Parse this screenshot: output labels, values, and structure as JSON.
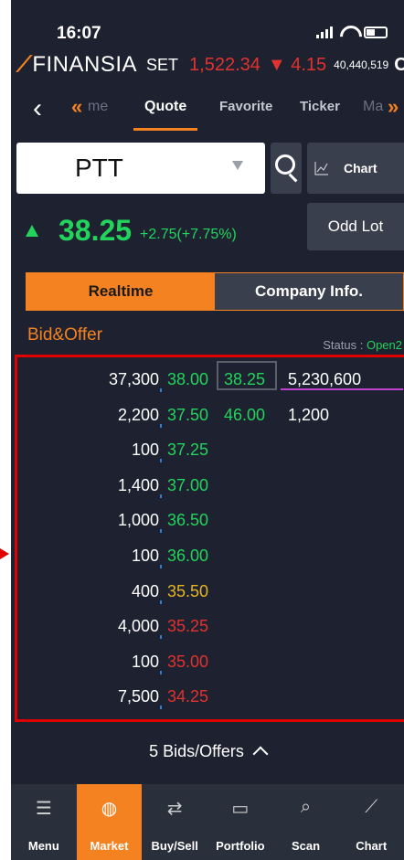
{
  "status": {
    "time": "16:07"
  },
  "ticker": {
    "brand": "FINANSIA",
    "index_name": "SET",
    "index_value": "1,522.34",
    "index_change": "▼ 4.15",
    "index_volume": "40,440,519",
    "overflow": "C"
  },
  "tabs": [
    {
      "label": "me"
    },
    {
      "label": "Quote"
    },
    {
      "label": "Favorite"
    },
    {
      "label": "Ticker"
    },
    {
      "label": "Ma"
    }
  ],
  "search": {
    "symbol": "PTT"
  },
  "chart_button": {
    "label": "Chart"
  },
  "price": {
    "last": "38.25",
    "change": "+2.75(+7.75%)"
  },
  "odd_lot_button": {
    "label": "Odd Lot"
  },
  "subtabs": {
    "realtime": "Realtime",
    "company": "Company Info."
  },
  "bid_offer": {
    "title": "Bid&Offer",
    "status_label": "Status :",
    "status_value": "Open2",
    "rows": [
      {
        "bid_volume": "37,300",
        "bid": "38.00",
        "bid_color": "g",
        "offer": "38.25",
        "offer_volume": "5,230,600"
      },
      {
        "bid_volume": "2,200",
        "bid": "37.50",
        "bid_color": "g",
        "offer": "46.00",
        "offer_volume": "1,200"
      },
      {
        "bid_volume": "100",
        "bid": "37.25",
        "bid_color": "g",
        "offer": "",
        "offer_volume": ""
      },
      {
        "bid_volume": "1,400",
        "bid": "37.00",
        "bid_color": "g",
        "offer": "",
        "offer_volume": ""
      },
      {
        "bid_volume": "1,000",
        "bid": "36.50",
        "bid_color": "g",
        "offer": "",
        "offer_volume": ""
      },
      {
        "bid_volume": "100",
        "bid": "36.00",
        "bid_color": "g",
        "offer": "",
        "offer_volume": ""
      },
      {
        "bid_volume": "400",
        "bid": "35.50",
        "bid_color": "y",
        "offer": "",
        "offer_volume": ""
      },
      {
        "bid_volume": "4,000",
        "bid": "35.25",
        "bid_color": "r",
        "offer": "",
        "offer_volume": ""
      },
      {
        "bid_volume": "100",
        "bid": "35.00",
        "bid_color": "r",
        "offer": "",
        "offer_volume": ""
      },
      {
        "bid_volume": "7,500",
        "bid": "34.25",
        "bid_color": "r",
        "offer": "",
        "offer_volume": ""
      }
    ]
  },
  "five_bids": {
    "label": "5 Bids/Offers"
  },
  "bottom_nav": [
    {
      "label": "Menu",
      "icon": "menu-icon"
    },
    {
      "label": "Market",
      "icon": "globe-icon"
    },
    {
      "label": "Buy/Sell",
      "icon": "swap-icon"
    },
    {
      "label": "Portfolio",
      "icon": "wallet-icon"
    },
    {
      "label": "Scan",
      "icon": "search-icon"
    },
    {
      "label": "Chart",
      "icon": "chart-icon"
    }
  ],
  "colors": {
    "accent": "#f58220",
    "up": "#22d35c",
    "down": "#e0322f",
    "neutral": "#e5b523",
    "highlight": "#e00000"
  }
}
